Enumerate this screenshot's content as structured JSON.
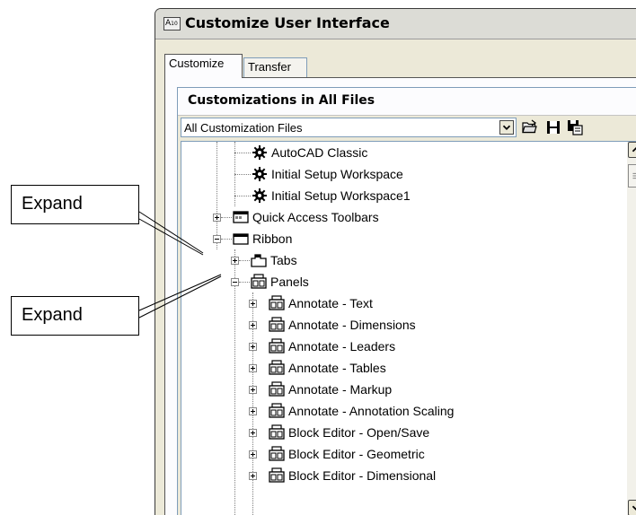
{
  "window": {
    "title": "Customize User Interface",
    "app_icon_text": "A",
    "app_icon_sub": "10"
  },
  "tabs": [
    {
      "label": "Customize",
      "active": true
    },
    {
      "label": "Transfer",
      "active": false
    }
  ],
  "section": {
    "title": "Customizations in All Files",
    "dropdown_value": "All Customization Files"
  },
  "tree": {
    "items": [
      {
        "label": "AutoCAD Classic",
        "icon": "workspace-icon",
        "expander": "none"
      },
      {
        "label": "Initial Setup Workspace",
        "icon": "workspace-icon",
        "expander": "none"
      },
      {
        "label": "Initial Setup Workspace1",
        "icon": "workspace-icon",
        "expander": "none"
      },
      {
        "label": "Quick Access Toolbars",
        "icon": "toolbar-icon",
        "expander": "plus"
      },
      {
        "label": "Ribbon",
        "icon": "ribbon-icon",
        "expander": "minus"
      },
      {
        "label": "Tabs",
        "icon": "tabs-icon",
        "expander": "plus"
      },
      {
        "label": "Panels",
        "icon": "panels-icon",
        "expander": "minus"
      },
      {
        "label": "Annotate - Text",
        "icon": "panel-icon",
        "expander": "plus"
      },
      {
        "label": "Annotate - Dimensions",
        "icon": "panel-icon",
        "expander": "plus"
      },
      {
        "label": "Annotate - Leaders",
        "icon": "panel-icon",
        "expander": "plus"
      },
      {
        "label": "Annotate - Tables",
        "icon": "panel-icon",
        "expander": "plus"
      },
      {
        "label": "Annotate - Markup",
        "icon": "panel-icon",
        "expander": "plus"
      },
      {
        "label": "Annotate - Annotation Scaling",
        "icon": "panel-icon",
        "expander": "plus"
      },
      {
        "label": "Block Editor - Open/Save",
        "icon": "panel-icon",
        "expander": "plus"
      },
      {
        "label": "Block Editor - Geometric",
        "icon": "panel-icon",
        "expander": "plus"
      },
      {
        "label": "Block Editor - Dimensional",
        "icon": "panel-icon",
        "expander": "plus"
      }
    ]
  },
  "callouts": [
    {
      "text": "Expand",
      "target": "Ribbon"
    },
    {
      "text": "Expand",
      "target": "Panels"
    }
  ],
  "toolbar_icons": [
    "open-file-icon",
    "save-icon",
    "save-as-icon"
  ],
  "colors": {
    "window_bg": "#ece9d8",
    "border": "#7f9db9",
    "tree_bg": "#ffffff"
  }
}
